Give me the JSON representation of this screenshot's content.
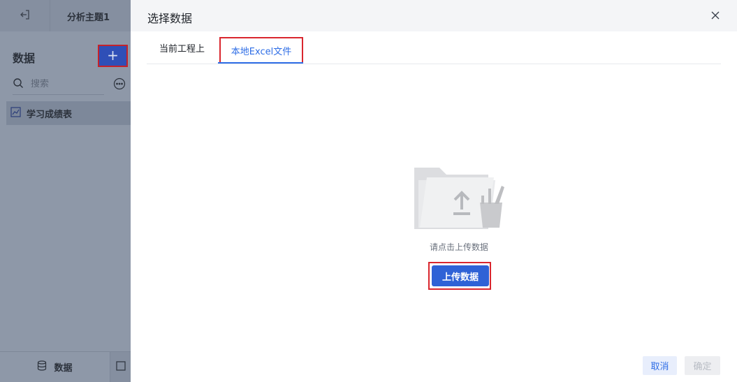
{
  "app": {
    "topic_title": "分析主题1",
    "panel_title": "数据",
    "add_label": "+",
    "search": {
      "placeholder": "搜索"
    },
    "data_items": [
      {
        "label": "学习成绩表"
      }
    ],
    "bottom_tabs": [
      {
        "label": "数据",
        "icon": "database-icon"
      }
    ]
  },
  "dialog": {
    "title": "选择数据",
    "tabs": [
      {
        "label": "当前工程上",
        "active": false
      },
      {
        "label": "本地Excel文件",
        "active": true
      }
    ],
    "hint": "请点击上传数据",
    "upload_label": "上传数据",
    "cancel_label": "取消",
    "ok_label": "确定"
  },
  "colors": {
    "accent": "#2f6ee6",
    "primary_button": "#2f62d6",
    "highlight_border": "#d9262e",
    "overlay": "#8e98a8"
  }
}
